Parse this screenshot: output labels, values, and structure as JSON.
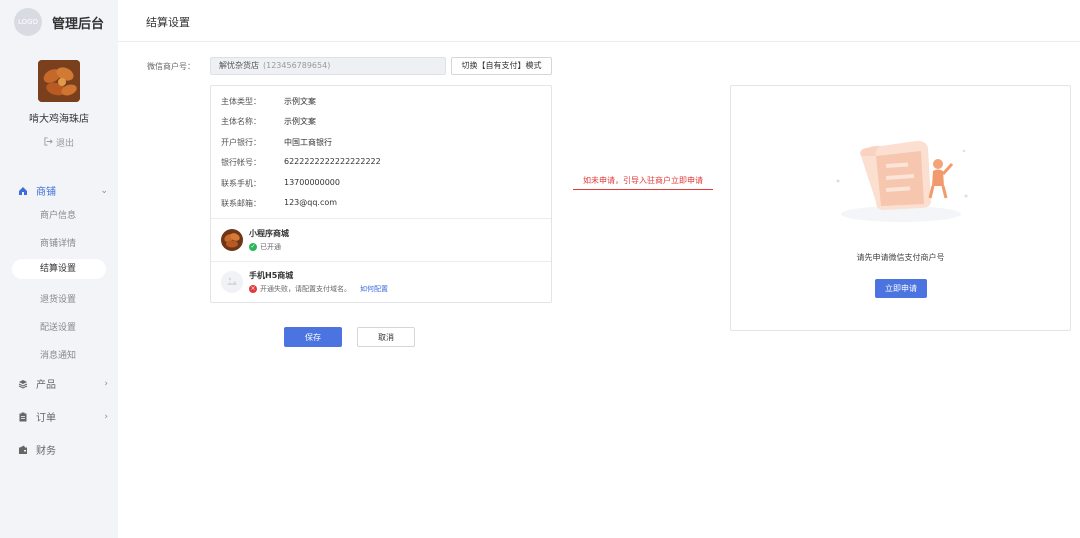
{
  "brand": {
    "logo_text": "LOGO",
    "title": "管理后台"
  },
  "store": {
    "name": "啃大鸡海珠店",
    "logout_label": "退出"
  },
  "sidebar": {
    "groups": [
      {
        "label": "商铺",
        "icon": "home-icon"
      },
      {
        "label": "产品",
        "icon": "layers-icon"
      },
      {
        "label": "订单",
        "icon": "clipboard-icon"
      },
      {
        "label": "财务",
        "icon": "wallet-icon"
      }
    ],
    "sub_items": [
      {
        "label": "商户信息"
      },
      {
        "label": "商铺详情"
      },
      {
        "label": "结算设置"
      },
      {
        "label": "退货设置"
      },
      {
        "label": "配送设置"
      },
      {
        "label": "消息通知"
      }
    ]
  },
  "header": {
    "title": "结算设置"
  },
  "form": {
    "merchant_label": "微信商户号：",
    "merchant_name": "解忧杂货店",
    "merchant_id": "(123456789654)",
    "switch_label": "切换【自有支付】模式",
    "info_rows": [
      {
        "key": "主体类型：",
        "value": "示例文案"
      },
      {
        "key": "主体名称：",
        "value": "示例文案"
      },
      {
        "key": "开户银行：",
        "value": "中国工商银行"
      },
      {
        "key": "银行帐号：",
        "value": "6222222222222222222"
      },
      {
        "key": "联系手机：",
        "value": "13700000000"
      },
      {
        "key": "联系邮箱：",
        "value": "123@qq.com"
      }
    ],
    "channels": [
      {
        "title": "小程序商城",
        "status": "已开通",
        "link": ""
      },
      {
        "title": "手机H5商城",
        "status": "开通失败，请配置支付域名。",
        "link": "如何配置"
      }
    ],
    "save_label": "保存",
    "cancel_label": "取消"
  },
  "annotation": {
    "text": "如未申请，引导入驻商户立即申请"
  },
  "apply_card": {
    "text": "请先申请微信支付商户号",
    "button_label": "立即申请"
  },
  "colors": {
    "accent": "#4c74e0",
    "success": "#2db55d",
    "error": "#e23a3a",
    "annotation": "#e23a3a"
  }
}
